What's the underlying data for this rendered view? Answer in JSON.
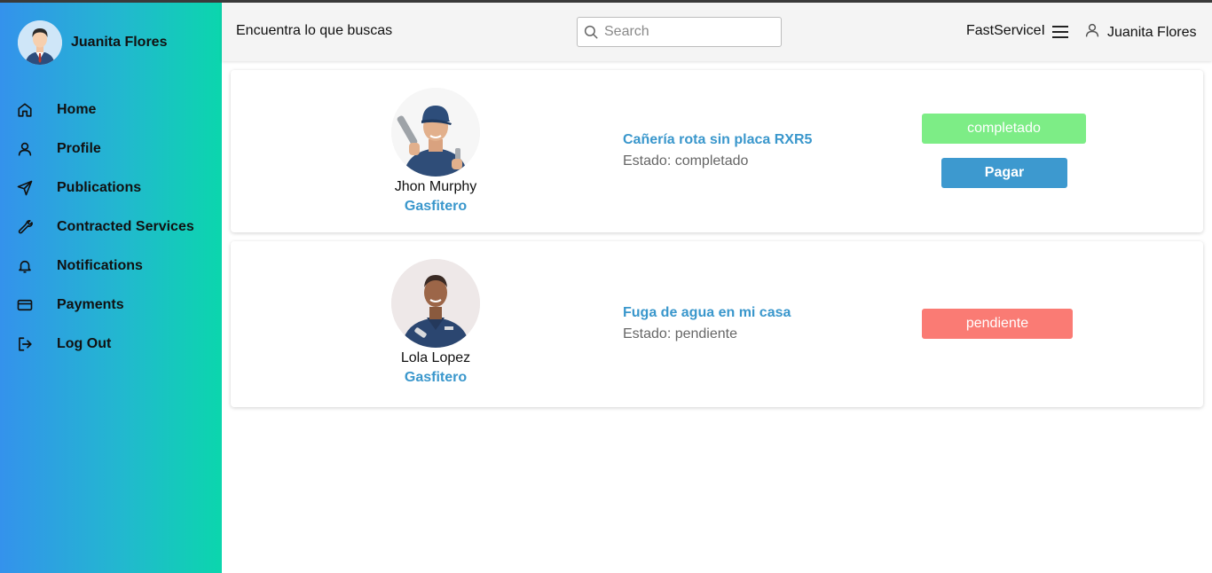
{
  "sidebar": {
    "user_name": "Juanita Flores",
    "items": [
      {
        "label": "Home",
        "icon": "home-icon"
      },
      {
        "label": "Profile",
        "icon": "user-icon"
      },
      {
        "label": "Publications",
        "icon": "send-icon"
      },
      {
        "label": "Contracted Services",
        "icon": "wrench-icon"
      },
      {
        "label": "Notifications",
        "icon": "bell-icon"
      },
      {
        "label": "Payments",
        "icon": "credit-card-icon"
      },
      {
        "label": "Log Out",
        "icon": "logout-icon"
      }
    ],
    "colors": {
      "gradient_start": "#3492ec",
      "gradient_end": "#0bd6ad"
    }
  },
  "header": {
    "tagline": "Encuentra lo que buscas",
    "search_placeholder": "Search",
    "brand": "FastServiceI",
    "user_name": "Juanita Flores"
  },
  "services": [
    {
      "worker_name": "Jhon Murphy",
      "worker_role": "Gasfitero",
      "title": "Cañería rota sin placa RXR5",
      "state_text": "Estado: completado",
      "status_badge": "completado",
      "status_color": "#7ded86",
      "action_label": "Pagar",
      "action_color": "#3d99cf"
    },
    {
      "worker_name": "Lola Lopez",
      "worker_role": "Gasfitero",
      "title": "Fuga de agua en mi casa",
      "state_text": "Estado: pendiente",
      "status_badge": "pendiente",
      "status_color": "#fa7b74"
    }
  ]
}
